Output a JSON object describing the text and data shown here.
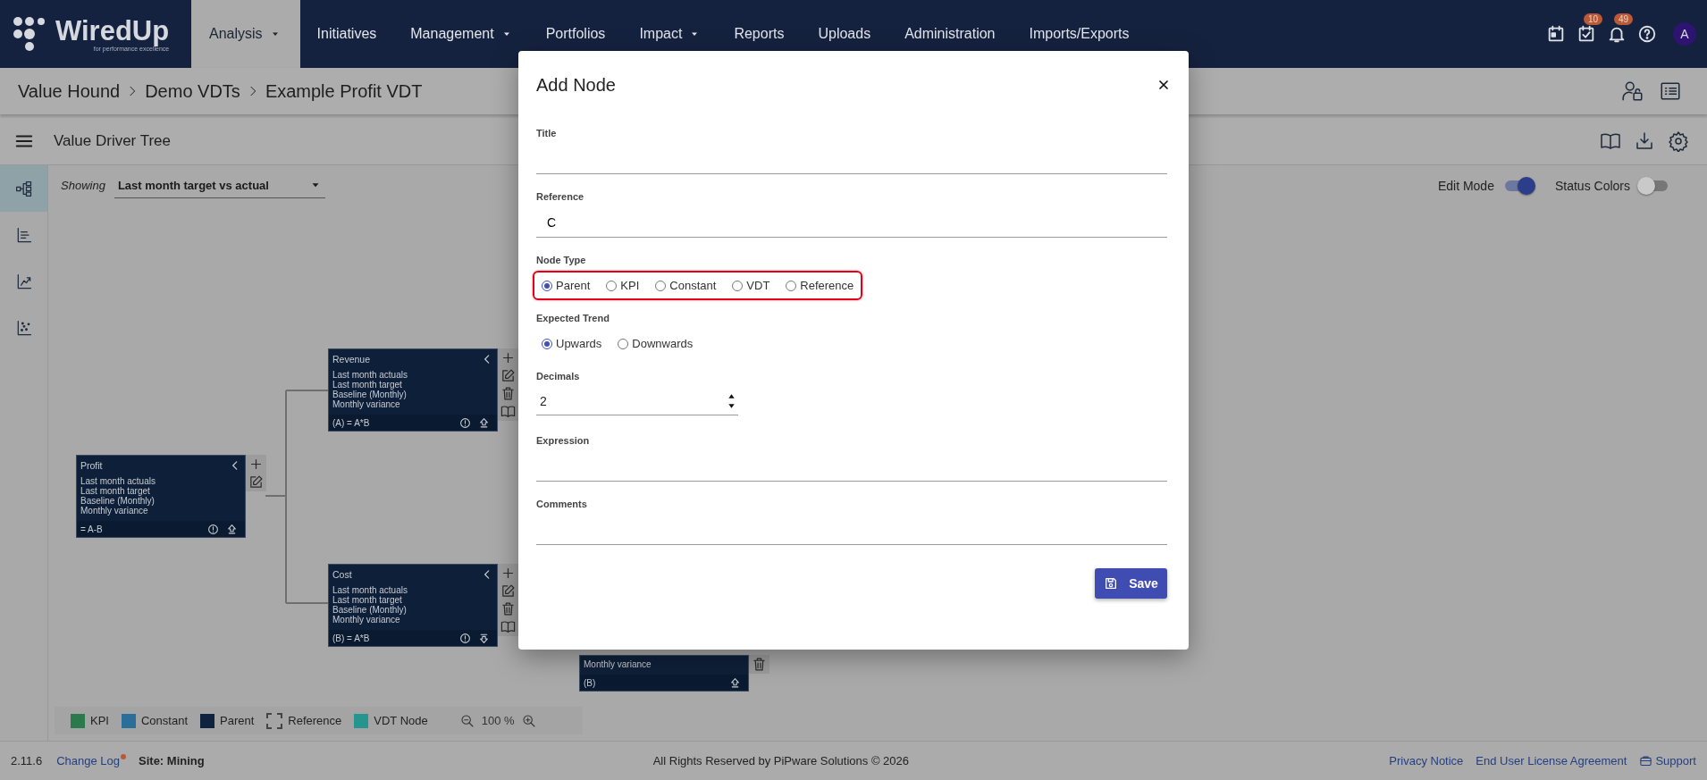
{
  "header": {
    "logo": {
      "name": "WiredUp",
      "tagline": "for performance excellence"
    },
    "nav": [
      {
        "label": "Analysis",
        "selected": true,
        "dropdown": true
      },
      {
        "label": "Initiatives",
        "selected": false,
        "dropdown": false
      },
      {
        "label": "Management",
        "selected": false,
        "dropdown": true
      },
      {
        "label": "Portfolios",
        "selected": false,
        "dropdown": false
      },
      {
        "label": "Impact",
        "selected": false,
        "dropdown": true
      },
      {
        "label": "Reports",
        "selected": false,
        "dropdown": false
      },
      {
        "label": "Uploads",
        "selected": false,
        "dropdown": false
      },
      {
        "label": "Administration",
        "selected": false,
        "dropdown": false
      },
      {
        "label": "Imports/Exports",
        "selected": false,
        "dropdown": false
      }
    ],
    "icons": [
      {
        "kind": "calendar"
      },
      {
        "kind": "tasks",
        "badge": "10"
      },
      {
        "kind": "bell",
        "badge": "49"
      },
      {
        "kind": "help"
      }
    ],
    "avatar": "A"
  },
  "breadcrumb": [
    "Value Hound",
    "Demo VDTs",
    "Example Profit VDT"
  ],
  "toolbar": {
    "title": "Value Driver Tree"
  },
  "rail": [
    {
      "kind": "tree",
      "selected": true
    },
    {
      "kind": "list",
      "selected": false
    },
    {
      "kind": "trend",
      "selected": false
    },
    {
      "kind": "scatter",
      "selected": false
    }
  ],
  "showing": {
    "label": "Showing",
    "value": "Last month target vs actual"
  },
  "toggles": [
    {
      "label": "Edit Mode",
      "on": true
    },
    {
      "label": "Status Colors",
      "on": false
    }
  ],
  "nodes": [
    {
      "title": "Profit",
      "lines": [
        "Last month actuals",
        "Last month target",
        "Baseline (Monthly)",
        "Monthly variance"
      ],
      "footer": "= A-B",
      "footer_icons": [
        {
          "kind": "info"
        },
        {
          "kind": "promote"
        }
      ],
      "actions": [
        {
          "kind": "add"
        },
        {
          "kind": "edit"
        }
      ]
    },
    {
      "title": "Revenue",
      "lines": [
        "Last month actuals",
        "Last month target",
        "Baseline (Monthly)",
        "Monthly variance"
      ],
      "footer": "(A) = A*B",
      "footer_icons": [
        {
          "kind": "info"
        },
        {
          "kind": "promote"
        }
      ],
      "actions": [
        {
          "kind": "add"
        },
        {
          "kind": "edit"
        },
        {
          "kind": "delete"
        },
        {
          "kind": "book"
        }
      ]
    },
    {
      "title": "Cost",
      "lines": [
        "Last month actuals",
        "Last month target",
        "Baseline (Monthly)",
        "Monthly variance"
      ],
      "footer": "(B) = A*B",
      "footer_icons": [
        {
          "kind": "info"
        },
        {
          "kind": "demote"
        }
      ],
      "actions": [
        {
          "kind": "add"
        },
        {
          "kind": "edit"
        },
        {
          "kind": "delete"
        },
        {
          "kind": "book"
        }
      ]
    },
    {
      "lines": [
        "Monthly variance"
      ],
      "footer": "(B)",
      "footer_icons": [
        {
          "kind": "promote"
        }
      ],
      "actions": [
        {
          "kind": "delete"
        }
      ]
    }
  ],
  "legend": {
    "items": [
      {
        "label": "KPI",
        "kind": "solid",
        "color": "#2b7a4b"
      },
      {
        "label": "Constant",
        "kind": "solid",
        "color": "#2a6e99"
      },
      {
        "label": "Parent",
        "kind": "solid",
        "color": "#0f2240"
      },
      {
        "label": "Reference",
        "kind": "dashed"
      },
      {
        "label": "VDT Node",
        "kind": "solid",
        "color": "#26958f"
      }
    ],
    "zoom": "100 %"
  },
  "footer": {
    "version": "2.11.6",
    "changelog": {
      "label": "Change Log",
      "unread": true
    },
    "site": "Site: Mining",
    "copyright": "All Rights Reserved by PiPware Solutions © 2026",
    "links": [
      {
        "label": "Privacy Notice"
      },
      {
        "label": "End User License Agreement"
      },
      {
        "label": "Support",
        "icon": true
      }
    ]
  },
  "modal": {
    "title": "Add Node",
    "fields": [
      {
        "kind": "text",
        "label": "Title"
      },
      {
        "kind": "text",
        "label": "Reference",
        "value": "C"
      },
      {
        "kind": "radio",
        "label": "Node Type",
        "highlighted": true,
        "options": [
          {
            "label": "Parent",
            "selected": true
          },
          {
            "label": "KPI",
            "selected": false
          },
          {
            "label": "Constant",
            "selected": false
          },
          {
            "label": "VDT",
            "selected": false
          },
          {
            "label": "Reference",
            "selected": false
          }
        ]
      },
      {
        "kind": "radio",
        "label": "Expected Trend",
        "highlighted": false,
        "options": [
          {
            "label": "Upwards",
            "selected": true
          },
          {
            "label": "Downwards",
            "selected": false
          }
        ]
      },
      {
        "kind": "number",
        "label": "Decimals",
        "value": "2"
      },
      {
        "kind": "text",
        "label": "Expression"
      },
      {
        "kind": "textarea",
        "label": "Comments"
      }
    ],
    "save": "Save"
  }
}
